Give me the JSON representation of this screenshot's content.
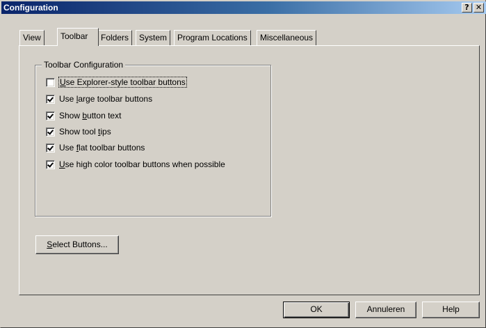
{
  "window": {
    "title": "Configuration",
    "help_button": "?",
    "close_button": "✕"
  },
  "tabs": [
    {
      "label": "View",
      "active": false
    },
    {
      "label": "Toolbar",
      "active": true
    },
    {
      "label": "Folders",
      "active": false
    },
    {
      "label": "System",
      "active": false
    },
    {
      "label": "Program Locations",
      "active": false
    },
    {
      "label": "Miscellaneous",
      "active": false
    }
  ],
  "group": {
    "title": "Toolbar Configuration",
    "options": [
      {
        "pre": "",
        "u": "U",
        "post": "se Explorer-style toolbar buttons",
        "checked": false
      },
      {
        "pre": "Use ",
        "u": "l",
        "post": "arge toolbar buttons",
        "checked": true
      },
      {
        "pre": "Show ",
        "u": "b",
        "post": "utton text",
        "checked": true
      },
      {
        "pre": "Show tool ",
        "u": "t",
        "post": "ips",
        "checked": true
      },
      {
        "pre": "Use ",
        "u": "f",
        "post": "lat toolbar buttons",
        "checked": true
      },
      {
        "pre": "",
        "u": "U",
        "post": "se high color toolbar buttons when possible",
        "checked": true
      }
    ]
  },
  "select_buttons": {
    "u": "S",
    "post": "elect Buttons..."
  },
  "footer": {
    "ok": "OK",
    "cancel": "Annuleren",
    "help": "Help"
  }
}
